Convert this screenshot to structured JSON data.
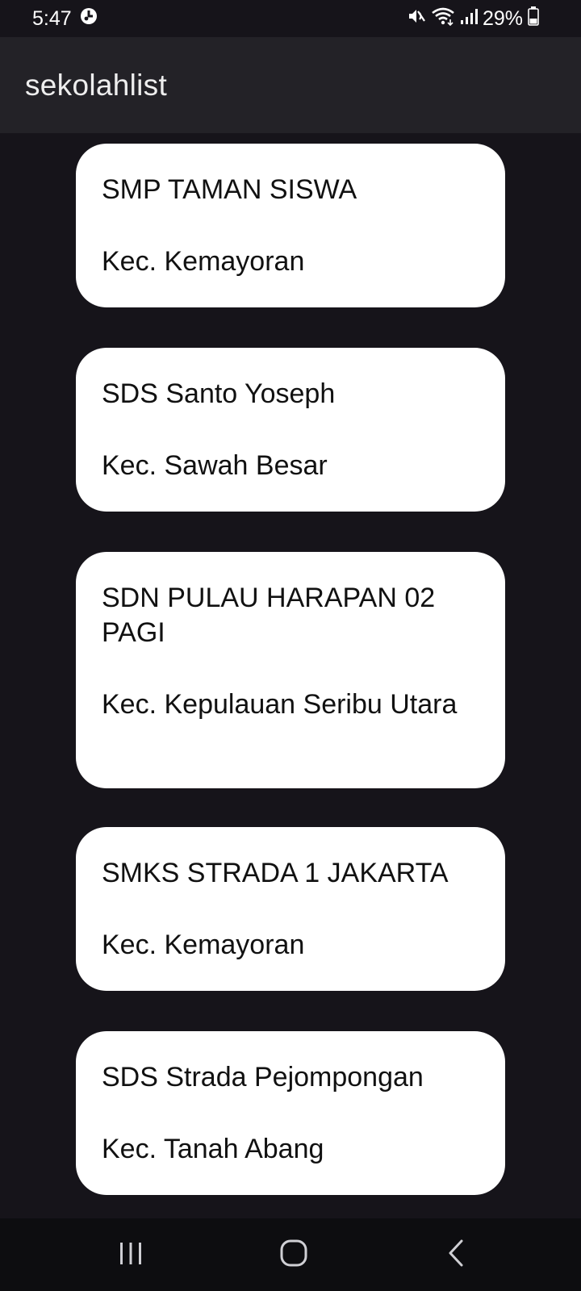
{
  "status_bar": {
    "time": "5:47",
    "battery": "29%",
    "icons": [
      "notification-icon",
      "mute-icon",
      "wifi-icon",
      "signal-icon",
      "battery-icon"
    ]
  },
  "app_bar": {
    "title": "sekolahlist"
  },
  "schools": [
    {
      "name": "SMP TAMAN SISWA",
      "district": "Kec. Kemayoran"
    },
    {
      "name": "SDS Santo Yoseph",
      "district": "Kec. Sawah Besar"
    },
    {
      "name": "SDN PULAU HARAPAN 02 PAGI",
      "district": "Kec. Kepulauan Seribu Utara"
    },
    {
      "name": "SMKS STRADA 1 JAKARTA",
      "district": "Kec. Kemayoran"
    },
    {
      "name": "SDS Strada Pejompongan",
      "district": "Kec. Tanah Abang"
    }
  ],
  "nav_bar": {
    "icons": [
      "recent-apps-icon",
      "home-icon",
      "back-icon"
    ]
  },
  "colors": {
    "background": "#16141a",
    "app_bar": "#232227",
    "card": "#ffffff",
    "nav_bar": "#0d0d10"
  }
}
